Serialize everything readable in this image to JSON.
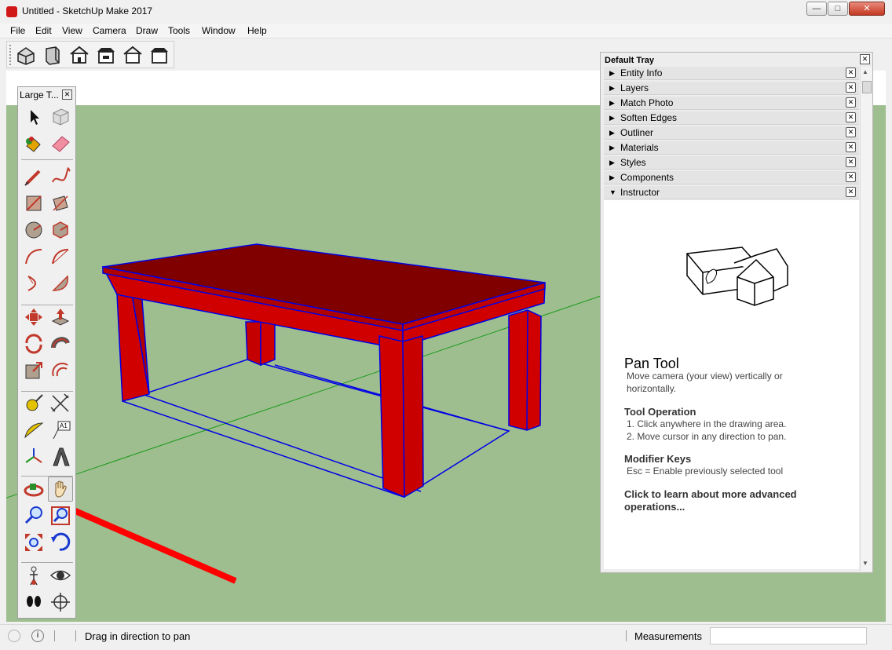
{
  "window": {
    "title": "Untitled - SketchUp Make 2017",
    "minimize": "—",
    "maximize": "□",
    "close": "✕"
  },
  "menu": [
    "File",
    "Edit",
    "View",
    "Camera",
    "Draw",
    "Tools",
    "Window",
    "Help"
  ],
  "toolbar": {
    "buttons": [
      "iso-view-icon",
      "top-view-icon",
      "front-view-icon",
      "right-view-icon",
      "back-view-icon",
      "left-view-icon"
    ]
  },
  "large_toolset": {
    "title": "Large T...",
    "close": "✕",
    "tools": [
      "select-icon",
      "make-component-icon",
      "paint-bucket-icon",
      "eraser-icon",
      "line-icon",
      "freehand-icon",
      "rectangle-icon",
      "rotated-rectangle-icon",
      "circle-icon",
      "polygon-icon",
      "arc-icon",
      "two-point-arc-icon",
      "three-point-arc-icon",
      "pie-icon",
      "move-icon",
      "push-pull-icon",
      "rotate-icon",
      "follow-me-icon",
      "scale-icon",
      "offset-icon",
      "tape-measure-icon",
      "dimension-icon",
      "protractor-icon",
      "text-icon",
      "axes-icon",
      "3d-text-icon",
      "orbit-icon",
      "pan-icon",
      "zoom-icon",
      "zoom-window-icon",
      "zoom-extents-icon",
      "previous-icon",
      "position-camera-icon",
      "look-around-icon",
      "walk-icon",
      "section-plane-icon"
    ],
    "text_tool_label": "A1"
  },
  "tray": {
    "title": "Default Tray",
    "close": "✕",
    "items": [
      {
        "label": "Entity Info",
        "arrow": "▶"
      },
      {
        "label": "Layers",
        "arrow": "▶"
      },
      {
        "label": "Match Photo",
        "arrow": "▶"
      },
      {
        "label": "Soften Edges",
        "arrow": "▶"
      },
      {
        "label": "Outliner",
        "arrow": "▶"
      },
      {
        "label": "Materials",
        "arrow": "▶"
      },
      {
        "label": "Styles",
        "arrow": "▶"
      },
      {
        "label": "Components",
        "arrow": "▶"
      },
      {
        "label": "Instructor",
        "arrow": "▼"
      }
    ],
    "item_close": "✕",
    "instructor": {
      "heading": "Pan Tool",
      "description": "Move camera (your view) vertically or horizontally.",
      "operation_title": "Tool Operation",
      "operation_steps": [
        "1. Click anywhere in the drawing area.",
        "2. Move cursor in any direction to pan."
      ],
      "modifier_title": "Modifier Keys",
      "modifier_text": "Esc = Enable previously selected tool",
      "advanced_link": "Click to learn about more advanced operations..."
    }
  },
  "statusbar": {
    "hint": "Drag in direction to pan",
    "measurements_label": "Measurements",
    "measurements_value": "",
    "info_icon": "i"
  },
  "colors": {
    "ground": "#9ebe8f",
    "table_side": "#d10000",
    "table_top": "#800000",
    "edge": "#0000e6",
    "axis_green": "#1a9a1a",
    "annotation_red": "#ff0000"
  }
}
